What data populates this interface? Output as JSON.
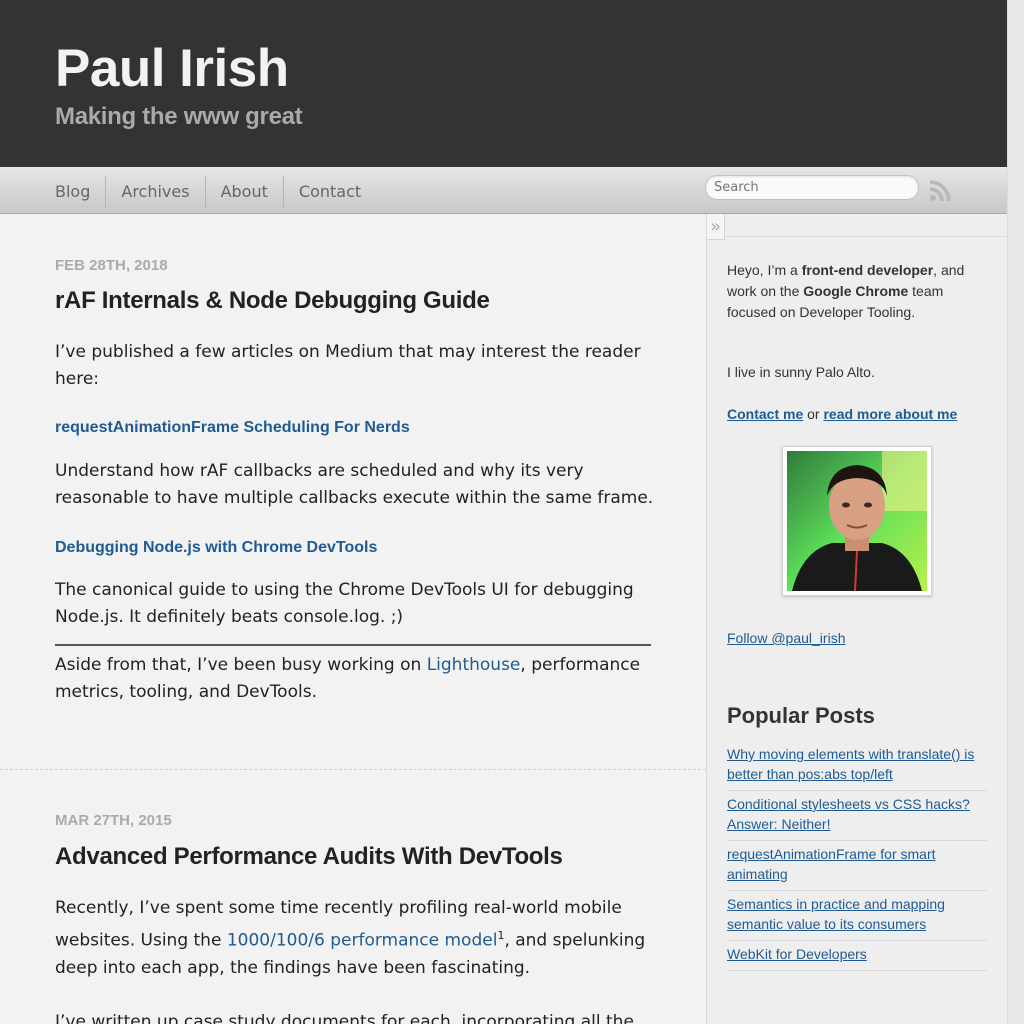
{
  "header": {
    "title": "Paul Irish",
    "subtitle": "Making the www great"
  },
  "nav": {
    "items": [
      {
        "label": "Blog"
      },
      {
        "label": "Archives"
      },
      {
        "label": "About"
      },
      {
        "label": "Contact"
      }
    ],
    "search_placeholder": "Search",
    "rss_icon": "rss-icon"
  },
  "posts": [
    {
      "date": "Feb 28th, 2018",
      "title": "rAF Internals & Node Debugging Guide",
      "intro": "I’ve published a few articles on Medium that may interest the reader here:",
      "link1": "requestAnimationFrame Scheduling For Nerds",
      "desc1": "Understand how rAF callbacks are scheduled and why its very reasonable to have multiple callbacks execute within the same frame.",
      "link2": "Debugging Node.js with Chrome DevTools",
      "desc2": "The canonical guide to using the Chrome DevTools UI for debugging Node.js. It definitely beats console.log. ;)",
      "aside_pre": "Aside from that, I’ve been busy working on ",
      "aside_link": "Lighthouse",
      "aside_post": ", performance metrics, tooling, and DevTools."
    },
    {
      "date": "Mar 27th, 2015",
      "title": "Advanced Performance Audits With DevTools",
      "p1_pre": "Recently, I’ve spent some time recently profiling real-world mobile websites. Using the ",
      "p1_link": "1000/100/6 performance model",
      "p1_sup": "1",
      "p1_post": ", and spelunking deep into each app, the findings have been fascinating.",
      "p2": "I’ve written up case study documents for each, incorporating all the"
    }
  ],
  "sidebar": {
    "toggle": "»",
    "bio_pre": "Heyo, I’m a ",
    "bio_bold1": "front-end developer",
    "bio_mid": ", and work on the ",
    "bio_bold2": "Google Chrome",
    "bio_post": " team focused on Developer Tooling.",
    "location": "I live in sunny Palo Alto.",
    "contact_link": "Contact me",
    "or_text": " or ",
    "about_link": "read more about me",
    "follow_link": "Follow @paul_irish",
    "popular_heading": "Popular Posts",
    "popular_posts": [
      "Why moving elements with translate() is better than pos:abs top/left",
      "Conditional stylesheets vs CSS hacks? Answer: Neither!",
      "requestAnimationFrame for smart animating",
      "Semantics in practice and mapping semantic value to its consumers",
      "WebKit for Developers"
    ]
  },
  "colors": {
    "header_bg": "#333333",
    "link": "#1f5b93",
    "page_bg": "#f2f2f2"
  }
}
